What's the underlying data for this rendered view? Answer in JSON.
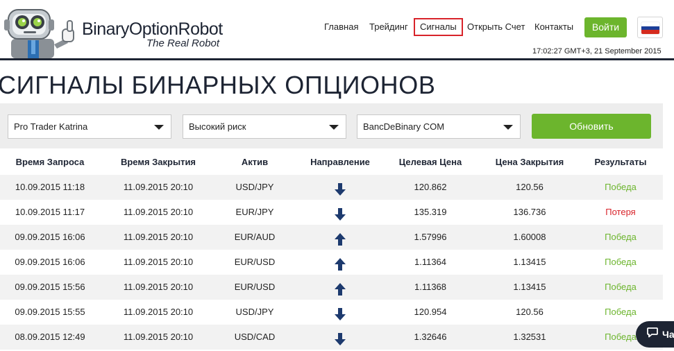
{
  "brand": {
    "name": "BinaryOptionRobot",
    "tagline": "The Real Robot"
  },
  "nav": {
    "items": [
      {
        "label": "Главная",
        "active": false
      },
      {
        "label": "Трейдинг",
        "active": false
      },
      {
        "label": "Сигналы",
        "active": true
      },
      {
        "label": "Открыть Счет",
        "active": false
      },
      {
        "label": "Контакты",
        "active": false
      }
    ],
    "login_label": "Войти",
    "language_flag": "russia-flag-icon"
  },
  "clock": "17:02:27 GMT+3, 21 September 2015",
  "page": {
    "title": "СИГНАЛЫ БИНАРНЫХ ОПЦИОНОВ"
  },
  "filters": {
    "trader": "Pro Trader Katrina",
    "risk": "Высокий риск",
    "broker": "BancDeBinary COM",
    "refresh_label": "Обновить"
  },
  "table": {
    "headers": [
      "Время Запроса",
      "Время Закрытия",
      "Актив",
      "Направление",
      "Целевая Цена",
      "Цена Закрытия",
      "Результаты"
    ],
    "rows": [
      {
        "request": "10.09.2015 11:18",
        "close": "11.09.2015 20:10",
        "asset": "USD/JPY",
        "direction": "down",
        "target": "120.862",
        "close_price": "120.56",
        "result": "Победа",
        "result_type": "win"
      },
      {
        "request": "10.09.2015 11:17",
        "close": "11.09.2015 20:10",
        "asset": "EUR/JPY",
        "direction": "down",
        "target": "135.319",
        "close_price": "136.736",
        "result": "Потеря",
        "result_type": "loss"
      },
      {
        "request": "09.09.2015 16:06",
        "close": "11.09.2015 20:10",
        "asset": "EUR/AUD",
        "direction": "up",
        "target": "1.57996",
        "close_price": "1.60008",
        "result": "Победа",
        "result_type": "win"
      },
      {
        "request": "09.09.2015 16:06",
        "close": "11.09.2015 20:10",
        "asset": "EUR/USD",
        "direction": "up",
        "target": "1.11364",
        "close_price": "1.13415",
        "result": "Победа",
        "result_type": "win"
      },
      {
        "request": "09.09.2015 15:56",
        "close": "11.09.2015 20:10",
        "asset": "EUR/USD",
        "direction": "up",
        "target": "1.11368",
        "close_price": "1.13415",
        "result": "Победа",
        "result_type": "win"
      },
      {
        "request": "09.09.2015 15:55",
        "close": "11.09.2015 20:10",
        "asset": "USD/JPY",
        "direction": "down",
        "target": "120.954",
        "close_price": "120.56",
        "result": "Победа",
        "result_type": "win"
      },
      {
        "request": "08.09.2015 12:49",
        "close": "11.09.2015 20:10",
        "asset": "USD/CAD",
        "direction": "down",
        "target": "1.32646",
        "close_price": "1.32531",
        "result": "Победа",
        "result_type": "win"
      }
    ]
  },
  "chat": {
    "label": "Ча"
  },
  "colors": {
    "brand_dark": "#1d2433",
    "accent_green": "#6cb52d",
    "loss_red": "#d8232a",
    "active_nav_border": "#d8232a"
  }
}
